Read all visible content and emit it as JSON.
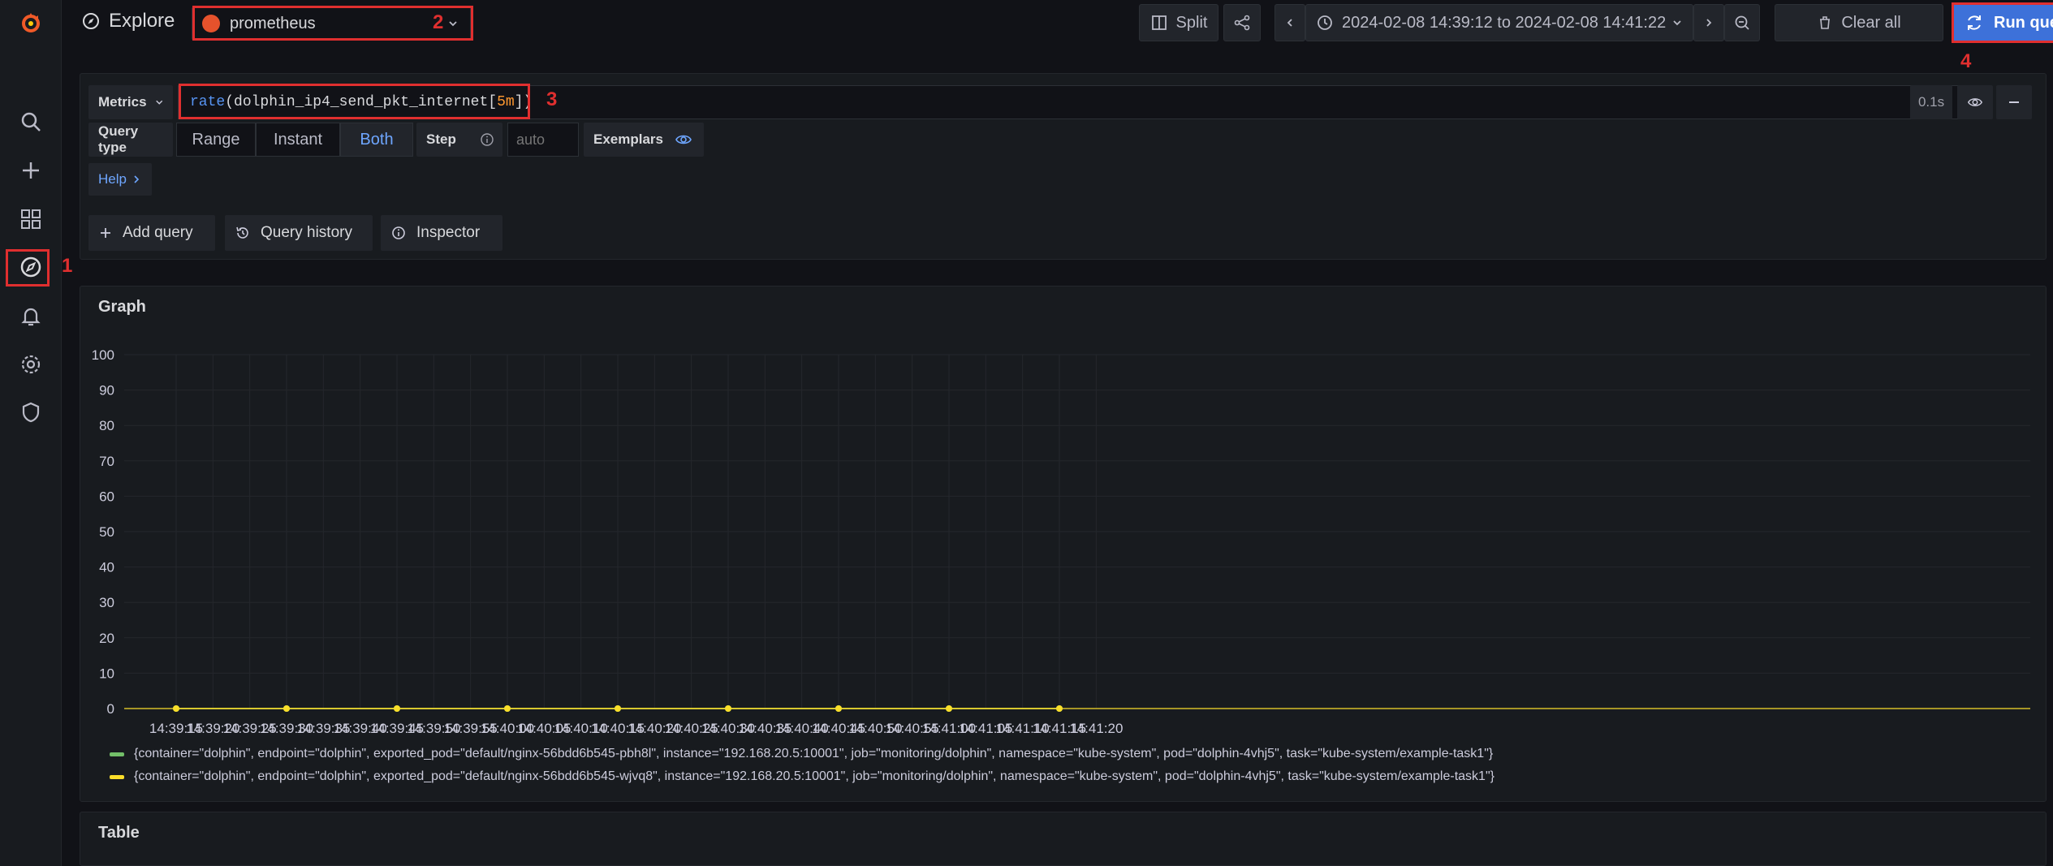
{
  "header": {
    "title": "Explore",
    "datasource": "prometheus",
    "split_label": "Split",
    "time_range": "2024-02-08 14:39:12 to 2024-02-08 14:41:22",
    "clear_all_label": "Clear all",
    "run_query_label": "Run query"
  },
  "annotations": [
    "1",
    "2",
    "3",
    "4"
  ],
  "sidebar": {
    "icons": [
      "grafana-logo-icon",
      "search-icon",
      "plus-icon",
      "dashboards-icon",
      "explore-icon",
      "bell-icon",
      "gear-icon",
      "shield-icon"
    ]
  },
  "query": {
    "mode_label": "Metrics",
    "fn": "rate",
    "metric": "dolphin_ip4_send_pkt_internet",
    "duration": "5m",
    "time_badge": "0.1s",
    "query_type_label": "Query type",
    "types": [
      "Range",
      "Instant",
      "Both"
    ],
    "active_type": "Both",
    "step_label": "Step",
    "step_placeholder": "auto",
    "exemplars_label": "Exemplars",
    "help_label": "Help",
    "add_query_label": "Add query",
    "query_history_label": "Query history",
    "inspector_label": "Inspector"
  },
  "graph": {
    "title": "Graph"
  },
  "table": {
    "title": "Table"
  },
  "colors": {
    "series1": "#73bf69",
    "series2": "#fade2a",
    "accent": "#3d71d9",
    "annotation": "#e02f2f"
  },
  "chart_data": {
    "type": "line",
    "title": "",
    "xlabel": "",
    "ylabel": "",
    "ylim": [
      0,
      100
    ],
    "yticks": [
      0,
      10,
      20,
      30,
      40,
      50,
      60,
      70,
      80,
      90,
      100
    ],
    "xticks": [
      "14:39:15",
      "14:39:20",
      "14:39:25",
      "14:39:30",
      "14:39:35",
      "14:39:40",
      "14:39:45",
      "14:39:50",
      "14:39:55",
      "14:40:00",
      "14:40:05",
      "14:40:10",
      "14:40:15",
      "14:40:20",
      "14:40:25",
      "14:40:30",
      "14:40:35",
      "14:40:40",
      "14:40:45",
      "14:40:50",
      "14:40:55",
      "14:41:00",
      "14:41:05",
      "14:41:10",
      "14:41:15",
      "14:41:20"
    ],
    "x": [
      "14:39:15",
      "14:39:30",
      "14:39:45",
      "14:40:00",
      "14:40:15",
      "14:40:30",
      "14:40:45",
      "14:41:00",
      "14:41:15"
    ],
    "series": [
      {
        "name": "{container=\"dolphin\", endpoint=\"dolphin\", exported_pod=\"default/nginx-56bdd6b545-pbh8l\", instance=\"192.168.20.5:10001\", job=\"monitoring/dolphin\", namespace=\"kube-system\", pod=\"dolphin-4vhj5\", task=\"kube-system/example-task1\"}",
        "values": [
          0,
          0,
          0,
          0,
          0,
          0,
          0,
          0,
          0
        ]
      },
      {
        "name": "{container=\"dolphin\", endpoint=\"dolphin\", exported_pod=\"default/nginx-56bdd6b545-wjvq8\", instance=\"192.168.20.5:10001\", job=\"monitoring/dolphin\", namespace=\"kube-system\", pod=\"dolphin-4vhj5\", task=\"kube-system/example-task1\"}",
        "values": [
          0,
          0,
          0,
          0,
          0,
          0,
          0,
          0,
          0
        ]
      }
    ],
    "legend": "bottom-left",
    "grid": true
  }
}
